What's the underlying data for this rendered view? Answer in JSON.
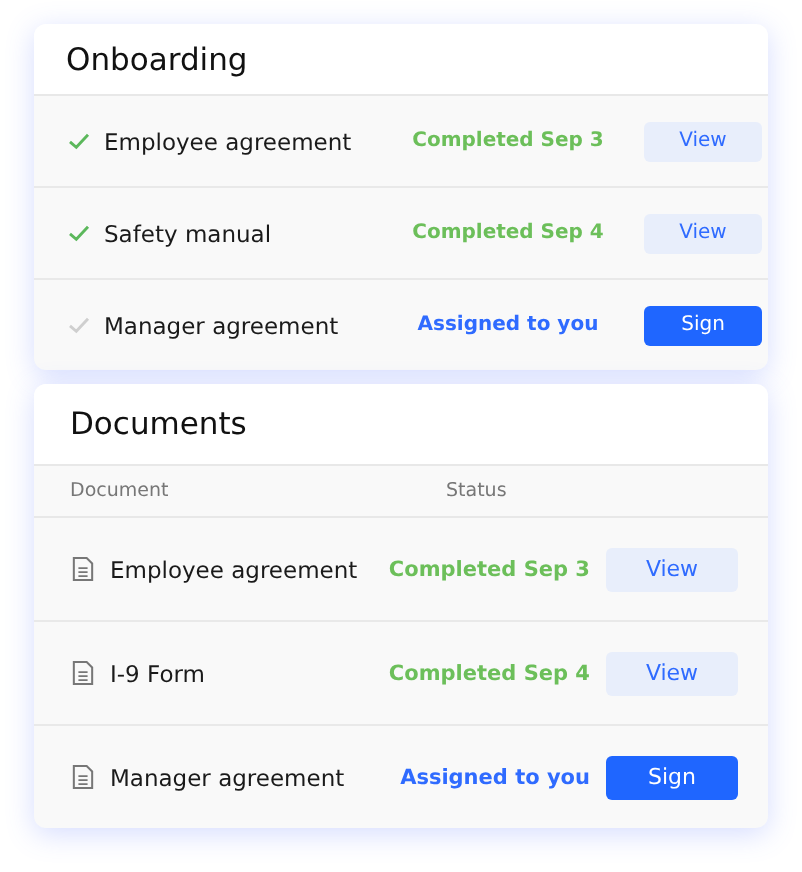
{
  "onboarding": {
    "title": "Onboarding",
    "items": [
      {
        "name": "Employee agreement",
        "done": true,
        "status": {
          "text": "Completed Sep 3",
          "kind": "completed"
        },
        "action": {
          "label": "View",
          "kind": "view"
        }
      },
      {
        "name": "Safety manual",
        "done": true,
        "status": {
          "text": "Completed Sep 4",
          "kind": "completed"
        },
        "action": {
          "label": "View",
          "kind": "view"
        }
      },
      {
        "name": "Manager agreement",
        "done": false,
        "status": {
          "text": "Assigned to you",
          "kind": "assigned"
        },
        "action": {
          "label": "Sign",
          "kind": "sign"
        }
      }
    ]
  },
  "documents": {
    "title": "Documents",
    "columns": [
      "Document",
      "Status"
    ],
    "rows": [
      {
        "name": "Employee agreement",
        "status": {
          "text": "Completed Sep 3",
          "kind": "completed"
        },
        "action": {
          "label": "View",
          "kind": "view"
        }
      },
      {
        "name": "I-9 Form",
        "status": {
          "text": "Completed Sep 4",
          "kind": "completed"
        },
        "action": {
          "label": "View",
          "kind": "view"
        }
      },
      {
        "name": "Manager agreement",
        "status": {
          "text": "Assigned to you",
          "kind": "assigned"
        },
        "action": {
          "label": "Sign",
          "kind": "sign"
        }
      }
    ]
  }
}
